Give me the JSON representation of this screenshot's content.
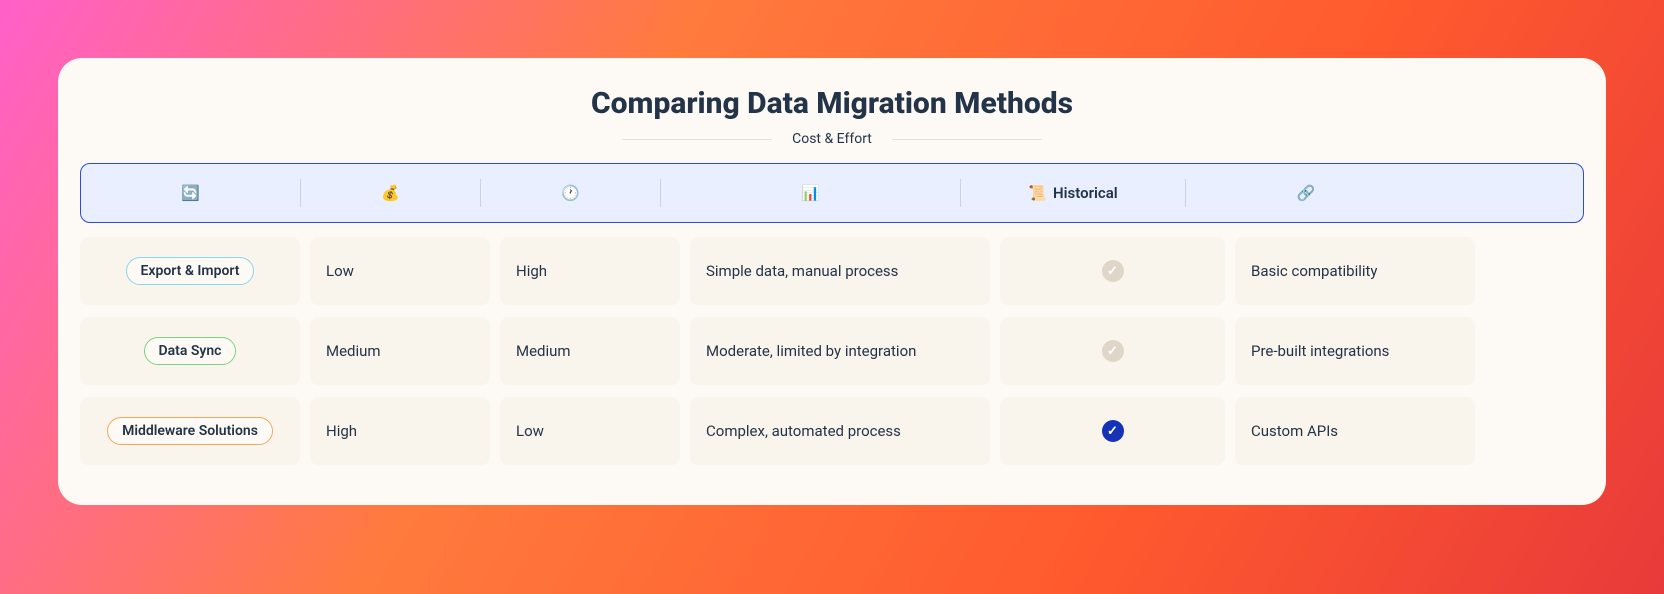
{
  "title": "Comparing Data Migration Methods",
  "subhead": "Cost & Effort",
  "headers": {
    "col0_icon": "🔄",
    "col1_icon": "💰",
    "col2_icon": "🕐",
    "col3_icon": "📊",
    "col4_icon": "📜",
    "col4_label": "Historical",
    "col5_icon": "🔗"
  },
  "rows": [
    {
      "name": "Export & Import",
      "pill": "pill-blue",
      "cost": "Low",
      "effort": "High",
      "complexity": "Simple data, manual process",
      "historical": "light",
      "integration": "Basic compatibility"
    },
    {
      "name": "Data Sync",
      "pill": "pill-green",
      "cost": "Medium",
      "effort": "Medium",
      "complexity": "Moderate, limited by integration",
      "historical": "light",
      "integration": "Pre-built integrations"
    },
    {
      "name": "Middleware Solutions",
      "pill": "pill-orange",
      "cost": "High",
      "effort": "Low",
      "complexity": "Complex, automated process",
      "historical": "dark",
      "integration": "Custom APIs"
    }
  ]
}
